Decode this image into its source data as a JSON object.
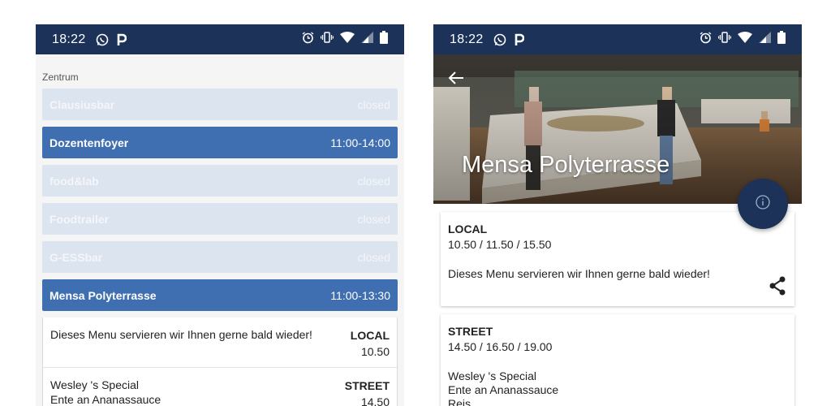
{
  "left": {
    "status": {
      "time": "18:22"
    },
    "section_label": "Zentrum",
    "venues": [
      {
        "name": "Clausiusbar",
        "hours": "closed",
        "state": "closed"
      },
      {
        "name": "Dozentenfoyer",
        "hours": "11:00-14:00",
        "state": "open"
      },
      {
        "name": "food&lab",
        "hours": "closed",
        "state": "closed"
      },
      {
        "name": "Foodtrailer",
        "hours": "closed",
        "state": "closed"
      },
      {
        "name": "G-ESSbar",
        "hours": "closed",
        "state": "closed"
      },
      {
        "name": "Mensa Polyterrasse",
        "hours": "11:00-13:30",
        "state": "open"
      }
    ],
    "menus": [
      {
        "desc_lines": [
          "Dieses Menu servieren wir Ihnen gerne bald wieder!"
        ],
        "category": "LOCAL",
        "price": "10.50"
      },
      {
        "desc_lines": [
          "Wesley 's Special",
          "Ente an Ananassauce"
        ],
        "category": "STREET",
        "price": "14.50"
      }
    ]
  },
  "right": {
    "status": {
      "time": "18:22"
    },
    "title": "Mensa Polyterrasse",
    "cards": [
      {
        "category": "LOCAL",
        "prices": "10.50 / 11.50 / 15.50",
        "desc_lines": [
          "Dieses Menu servieren wir Ihnen gerne bald wieder!"
        ]
      },
      {
        "category": "STREET",
        "prices": "14.50 / 16.50 / 19.00",
        "desc_lines": [
          "Wesley 's Special",
          "Ente an Ananassauce",
          "Reis"
        ]
      }
    ]
  },
  "icons": {
    "status_left": [
      "whatsapp-icon",
      "parking-icon"
    ],
    "status_right": [
      "alarm-icon",
      "vibrate-icon",
      "wifi-icon",
      "signal-icon",
      "battery-icon"
    ],
    "back": "back-arrow-icon",
    "info": "info-icon",
    "share": "share-icon"
  },
  "colors": {
    "statusbar": "#1c3258",
    "open_venue": "#3f6fb0",
    "closed_venue": "#dce4ef",
    "fab": "#1c3258"
  }
}
